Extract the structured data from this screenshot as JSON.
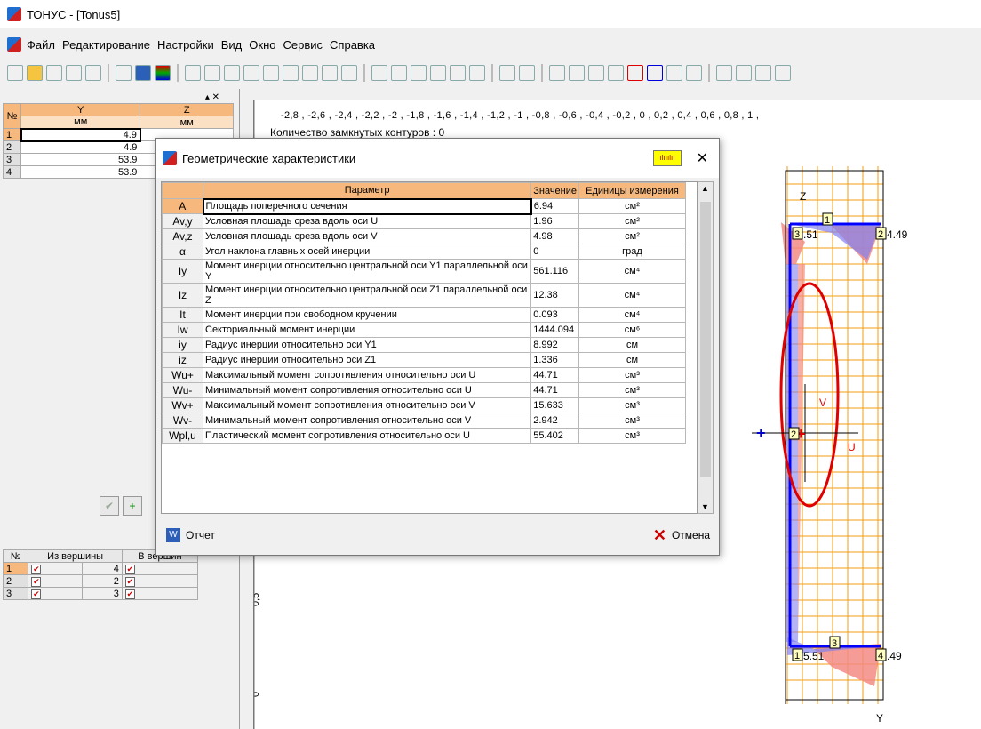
{
  "window": {
    "title": "ТОНУС - [Tonus5]"
  },
  "menu": {
    "items": [
      "Файл",
      "Редактирование",
      "Настройки",
      "Вид",
      "Окно",
      "Сервис",
      "Справка"
    ]
  },
  "coords_table": {
    "headers": [
      "№",
      "Y",
      "Z"
    ],
    "units": [
      "мм",
      "мм"
    ],
    "rows": [
      {
        "n": "1",
        "y": "4.9",
        "z": ""
      },
      {
        "n": "2",
        "y": "4.9",
        "z": ""
      },
      {
        "n": "3",
        "y": "53.9",
        "z": ""
      },
      {
        "n": "4",
        "y": "53.9",
        "z": ""
      }
    ]
  },
  "segments_table": {
    "headers": [
      "№",
      "Из вершины",
      "В вершин"
    ],
    "rows": [
      {
        "n": "1",
        "from": "4"
      },
      {
        "n": "2",
        "from": "2"
      },
      {
        "n": "3",
        "from": "3"
      }
    ]
  },
  "canvas": {
    "ruler_top": "-2,8 , -2,6 , -2,4 , -2,2 , -2 , -1,8 , -1,6 , -1,4 , -1,2 , -1 , -0,8 , -0,6 , -0,4 , -0,2 , 0 , 0,2 , 0,4 , 0,6 , 0,8 , 1 ,",
    "ruler_left": [
      "0,5",
      "0"
    ],
    "contours_label": "Количество замкнутых контуров : 0",
    "axis_labels": {
      "z": "Z",
      "y": "Y",
      "u": "U",
      "v": "V"
    },
    "node_labels": [
      "1",
      "2",
      "3",
      "4",
      "2",
      "1",
      "3"
    ],
    "dim_labels": {
      "top_right": "4.49",
      "bottom_right": ".49",
      "top_left": ".51",
      "bottom_left": "5.51"
    }
  },
  "dialog": {
    "title": "Геометрические характеристики",
    "headers": {
      "param": "Параметр",
      "value": "Значение",
      "units": "Единицы измерения"
    },
    "rows": [
      {
        "sym": "A",
        "param": "Площадь поперечного сечения",
        "value": "6.94",
        "unit": "см²"
      },
      {
        "sym": "Av,y",
        "param": "Условная площадь среза вдоль оси U",
        "value": "1.96",
        "unit": "см²"
      },
      {
        "sym": "Av,z",
        "param": "Условная площадь среза вдоль оси V",
        "value": "4.98",
        "unit": "см²"
      },
      {
        "sym": "α",
        "param": "Угол наклона главных осей инерции",
        "value": "0",
        "unit": "град"
      },
      {
        "sym": "Iy",
        "param": "Момент инерции относительно центральной оси Y1 параллельной оси Y",
        "value": "561.116",
        "unit": "см⁴"
      },
      {
        "sym": "Iz",
        "param": "Момент инерции относительно центральной оси Z1 параллельной оси Z",
        "value": "12.38",
        "unit": "см⁴"
      },
      {
        "sym": "It",
        "param": "Момент инерции при свободном кручении",
        "value": "0.093",
        "unit": "см⁴"
      },
      {
        "sym": "Iw",
        "param": "Секториальный момент инерции",
        "value": "1444.094",
        "unit": "см⁶"
      },
      {
        "sym": "iy",
        "param": "Радиус инерции относительно оси Y1",
        "value": "8.992",
        "unit": "см"
      },
      {
        "sym": "iz",
        "param": "Радиус инерции относительно оси Z1",
        "value": "1.336",
        "unit": "см"
      },
      {
        "sym": "Wu+",
        "param": "Максимальный момент сопротивления относительно оси U",
        "value": "44.71",
        "unit": "см³"
      },
      {
        "sym": "Wu-",
        "param": "Минимальный момент сопротивления относительно оси U",
        "value": "44.71",
        "unit": "см³"
      },
      {
        "sym": "Wv+",
        "param": "Максимальный момент сопротивления относительно оси V",
        "value": "15.633",
        "unit": "см³"
      },
      {
        "sym": "Wv-",
        "param": "Минимальный момент сопротивления относительно оси V",
        "value": "2.942",
        "unit": "см³"
      },
      {
        "sym": "Wpl,u",
        "param": "Пластический момент сопротивления относительно оси U",
        "value": "55.402",
        "unit": "см³"
      }
    ],
    "report_label": "Отчет",
    "cancel_label": "Отмена"
  }
}
